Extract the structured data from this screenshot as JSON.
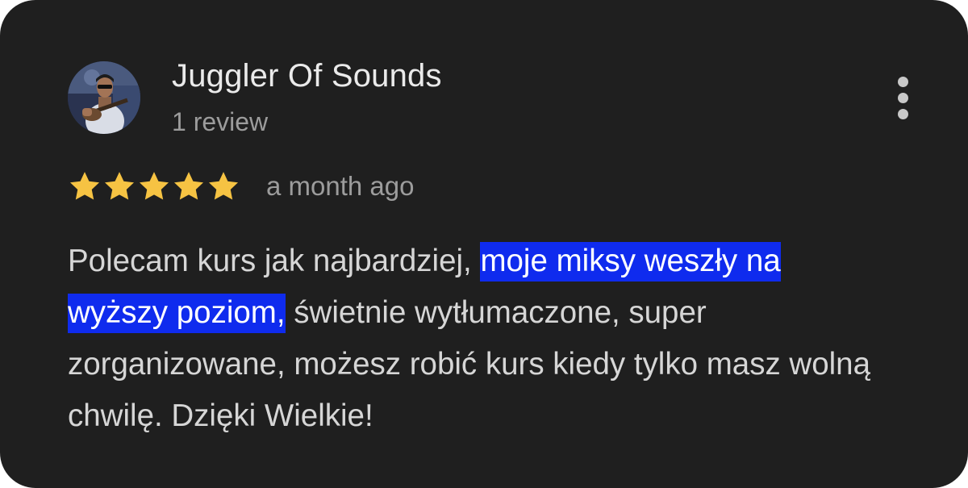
{
  "review": {
    "author_name": "Juggler Of Sounds",
    "author_meta": "1 review",
    "rating": 5,
    "rating_max": 5,
    "date": "a month ago",
    "text_before": "Polecam kurs jak najbardziej, ",
    "text_highlight_1": "moje miksy weszły na",
    "text_highlight_2": "wyższy poziom,",
    "text_after": " świetnie wytłumaczone, super zorganizowane, możesz robić kurs kiedy tylko masz wolną chwilę. Dzięki Wielkie!"
  },
  "icons": {
    "more": "more-vertical-icon",
    "star": "star-icon"
  },
  "colors": {
    "background": "#1f1f1f",
    "star": "#f6c343",
    "highlight": "#0f2bee",
    "name": "#eaeaea",
    "meta": "#9c9c9c"
  }
}
